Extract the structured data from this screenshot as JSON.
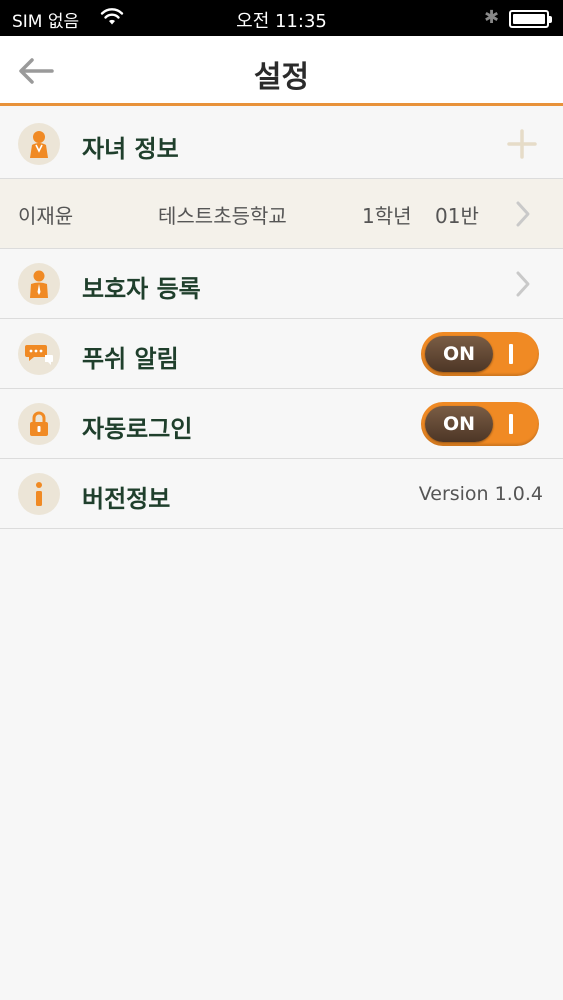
{
  "status_bar": {
    "carrier": "SIM 없음",
    "time": "오전 11:35"
  },
  "nav": {
    "title": "설정"
  },
  "rows": {
    "child_info": {
      "label": "자녀 정보"
    },
    "child": {
      "name": "이재윤",
      "school": "테스트초등학교",
      "grade": "1학년",
      "class": "01반"
    },
    "guardian": {
      "label": "보호자 등록"
    },
    "push": {
      "label": "푸쉬 알림",
      "toggle": "ON"
    },
    "autologin": {
      "label": "자동로그인",
      "toggle": "ON"
    },
    "version": {
      "label": "버전정보",
      "value": "Version 1.0.4"
    }
  },
  "colors": {
    "accent": "#e8923a",
    "toggle_on": "#f08a24",
    "label": "#1f3f2c",
    "icon_bg": "#ece5d7"
  }
}
